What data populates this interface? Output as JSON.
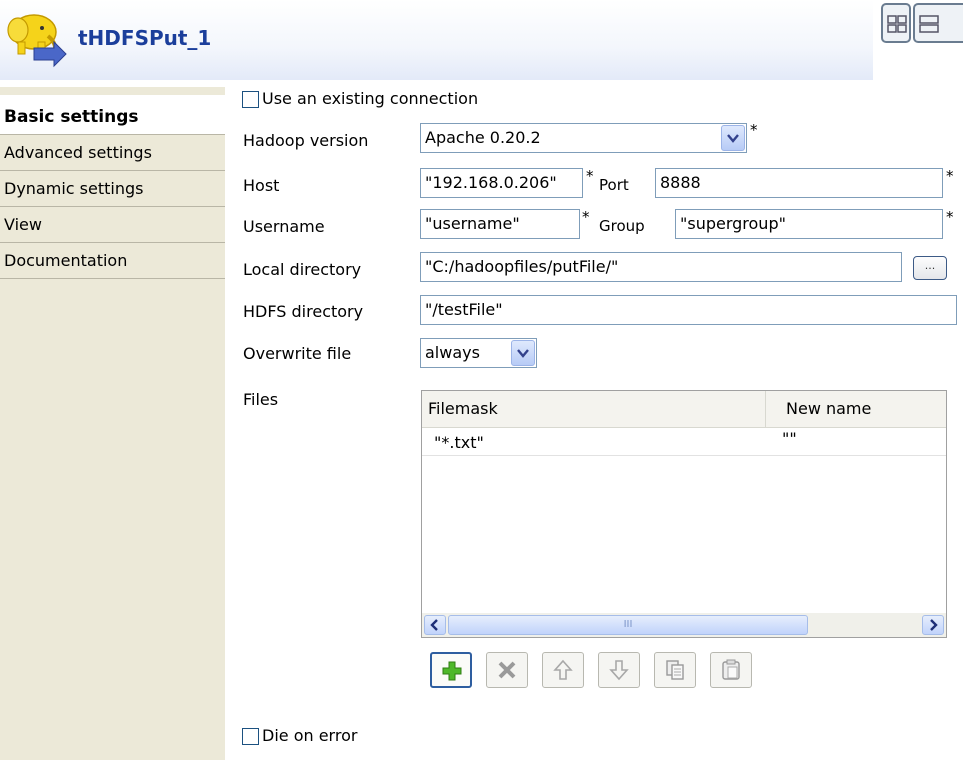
{
  "header": {
    "title": "tHDFSPut_1",
    "logo_icon": "hadoop-elephant-icon",
    "layout_buttons": [
      "table-layout-icon",
      "list-layout-icon"
    ]
  },
  "nav": {
    "items": [
      {
        "label": "Basic settings",
        "active": true
      },
      {
        "label": "Advanced settings",
        "active": false
      },
      {
        "label": "Dynamic settings",
        "active": false
      },
      {
        "label": "View",
        "active": false
      },
      {
        "label": "Documentation",
        "active": false
      }
    ]
  },
  "form": {
    "use_existing_connection": {
      "label": "Use an existing connection",
      "checked": false
    },
    "hadoop_version": {
      "label": "Hadoop version",
      "value": "Apache 0.20.2",
      "required": "*"
    },
    "host": {
      "label": "Host",
      "value": "\"192.168.0.206\"",
      "required": "*"
    },
    "port": {
      "label": "Port",
      "value": "8888",
      "required": "*"
    },
    "username": {
      "label": "Username",
      "value": "\"username\"",
      "required": "*"
    },
    "group": {
      "label": "Group",
      "value": "\"supergroup\"",
      "required": "*"
    },
    "local_directory": {
      "label": "Local directory",
      "value": "\"C:/hadoopfiles/putFile/\"",
      "browse_label": "..."
    },
    "hdfs_directory": {
      "label": "HDFS directory",
      "value": "\"/testFile\""
    },
    "overwrite_file": {
      "label": "Overwrite file",
      "value": "always"
    },
    "files": {
      "label": "Files",
      "columns": [
        "Filemask",
        "New name"
      ],
      "rows": [
        {
          "filemask": "\"*.txt\"",
          "new_name": "\"\""
        }
      ],
      "scrollbar_thumb_label": "III"
    },
    "table_toolbar": [
      "add-icon",
      "delete-icon",
      "move-up-icon",
      "move-down-icon",
      "copy-icon",
      "paste-icon"
    ],
    "die_on_error": {
      "label": "Die on error",
      "checked": false
    }
  },
  "colors": {
    "title_blue": "#1b3e9b",
    "nav_bg": "#ece9d8",
    "field_border": "#7f9db9"
  }
}
